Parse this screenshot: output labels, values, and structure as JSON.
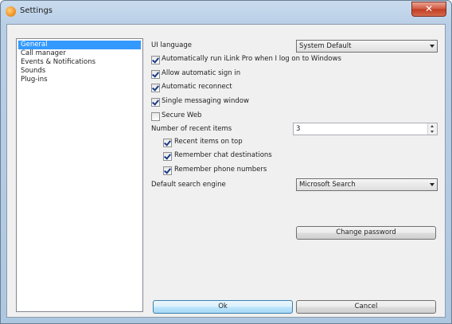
{
  "window": {
    "title": "Settings",
    "close_glyph": "✕"
  },
  "sidebar": {
    "items": [
      {
        "label": "General",
        "selected": true
      },
      {
        "label": "Call manager"
      },
      {
        "label": "Events & Notifications"
      },
      {
        "label": "Sounds"
      },
      {
        "label": "Plug-ins"
      }
    ]
  },
  "general": {
    "ui_language_label": "UI language",
    "ui_language_value": "System Default",
    "auto_run_label": "Automatically run iLink Pro when I log on to Windows",
    "auto_run_checked": true,
    "auto_sign_in_label": "Allow automatic sign in",
    "auto_sign_in_checked": true,
    "auto_reconnect_label": "Automatic reconnect",
    "auto_reconnect_checked": true,
    "single_window_label": "Single messaging window",
    "single_window_checked": true,
    "secure_web_label": "Secure Web",
    "secure_web_checked": false,
    "recent_items_label": "Number of recent items",
    "recent_items_value": "3",
    "recent_on_top_label": "Recent items on top",
    "recent_on_top_checked": true,
    "remember_chat_label": "Remember chat destinations",
    "remember_chat_checked": true,
    "remember_phone_label": "Remember phone numbers",
    "remember_phone_checked": true,
    "search_engine_label": "Default search engine",
    "search_engine_value": "Microsoft Search",
    "change_password_label": "Change password"
  },
  "footer": {
    "ok_label": "Ok",
    "cancel_label": "Cancel"
  },
  "colors": {
    "selection": "#3399ff",
    "default_button_border": "#3c7fb1"
  }
}
